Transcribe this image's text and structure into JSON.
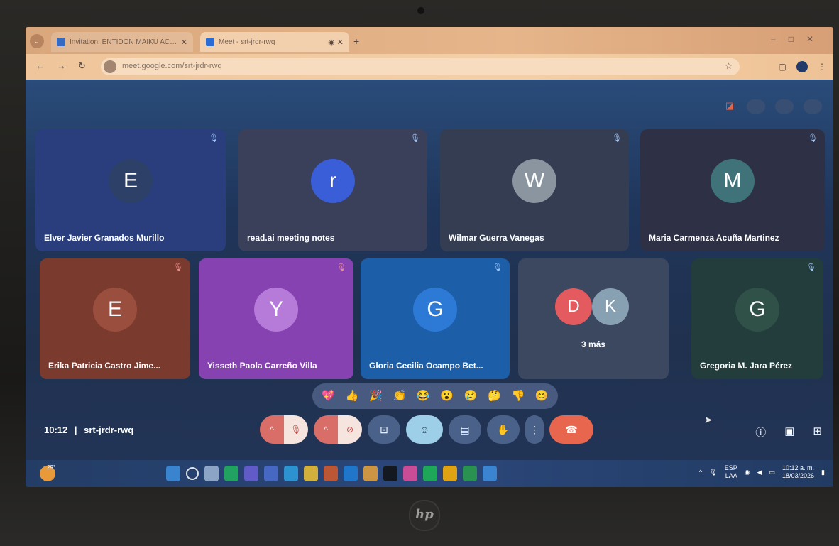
{
  "browser": {
    "tab1_title": "Invitation: ENTIDON MAIKU ACTI...",
    "tab2_title": "Meet - srt-jrdr-rwq",
    "url": "meet.google.com/srt-jrdr-rwq"
  },
  "meeting": {
    "time": "10:12",
    "separator": "|",
    "code": "srt-jrdr-rwq"
  },
  "participants": [
    {
      "initial": "E",
      "name": "Elver Javier Granados Murillo",
      "avatar_color": "#2c4068",
      "tile_color": "#2a3e7d"
    },
    {
      "initial": "r",
      "name": "read.ai meeting notes",
      "avatar_color": "#3a5ed8",
      "tile_color": "#3a3f5a"
    },
    {
      "initial": "W",
      "name": "Wilmar Guerra Vanegas",
      "avatar_color": "#8a95a0",
      "tile_color": "#343d52"
    },
    {
      "initial": "M",
      "name": "Maria Carmenza Acuña Martinez",
      "avatar_color": "#3f7279",
      "tile_color": "#2e3146"
    },
    {
      "initial": "E",
      "name": "Erika Patricia Castro Jime...",
      "avatar_color": "#9a4e3e",
      "tile_color": "#7a3a2e"
    },
    {
      "initial": "Y",
      "name": "Yisseth Paola Carreño Villa",
      "avatar_color": "#b67ad9",
      "tile_color": "#8542b0"
    },
    {
      "initial": "G",
      "name": "Gloria Cecilia Ocampo Bet...",
      "avatar_color": "#2d7ad6",
      "tile_color": "#1c5ea8"
    },
    {
      "initial": "G",
      "name": "Gregoria M. Jara Pérez",
      "avatar_color": "#2f5148",
      "tile_color": "#233c3c"
    }
  ],
  "more_tile": {
    "initials": [
      "D",
      "K"
    ],
    "colors": [
      "#e35a5f",
      "#87a1b3"
    ],
    "label": "3 más"
  },
  "reactions": [
    "💖",
    "👍",
    "🎉",
    "👏",
    "😂",
    "😮",
    "😢",
    "🤔",
    "👎",
    "😊"
  ],
  "taskbar": {
    "weather": "29°",
    "lang_top": "ESP",
    "lang_bottom": "LAA",
    "clock_time": "10:12 a. m.",
    "clock_date": "18/03/2026"
  },
  "icons": {
    "chevron": "chevron-up-icon",
    "mic": "mic-off-icon",
    "cam": "camera-off-icon",
    "present": "present-icon",
    "emoji": "emoji-icon",
    "captions": "captions-icon",
    "hand": "raise-hand-icon",
    "more": "more-options-icon",
    "end": "end-call-icon"
  },
  "logo": "hp"
}
